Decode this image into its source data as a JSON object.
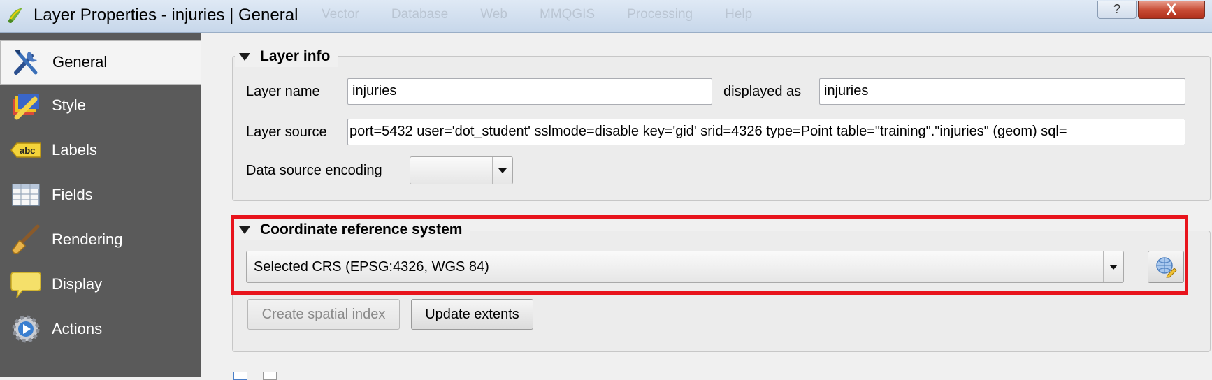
{
  "window": {
    "title": "Layer Properties - injuries | General",
    "background_menu": [
      "Vector",
      "Database",
      "Web",
      "MMQGIS",
      "Processing",
      "Help"
    ],
    "help_label": "?",
    "close_label": "X"
  },
  "sidebar": {
    "items": [
      {
        "label": "General",
        "icon": "tools-icon",
        "selected": true
      },
      {
        "label": "Style",
        "icon": "style-brush-icon"
      },
      {
        "label": "Labels",
        "icon": "abc-labels-icon"
      },
      {
        "label": "Fields",
        "icon": "table-fields-icon"
      },
      {
        "label": "Rendering",
        "icon": "paintbrush-icon"
      },
      {
        "label": "Display",
        "icon": "speech-bubble-icon"
      },
      {
        "label": "Actions",
        "icon": "gear-play-icon"
      }
    ]
  },
  "layer_info": {
    "title": "Layer info",
    "layer_name_label": "Layer name",
    "layer_name_value": "injuries",
    "displayed_as_label": "displayed as",
    "displayed_as_value": "injuries",
    "layer_source_label": "Layer source",
    "layer_source_value": "port=5432 user='dot_student' sslmode=disable key='gid' srid=4326 type=Point table=\"training\".\"injuries\" (geom) sql=",
    "encoding_label": "Data source encoding",
    "encoding_value": ""
  },
  "crs": {
    "title": "Coordinate reference system",
    "selected": "Selected CRS (EPSG:4326, WGS 84)",
    "select_crs_icon": "globe-crs-icon",
    "create_index_label": "Create spatial index",
    "update_extents_label": "Update extents"
  },
  "colors": {
    "highlight": "#e8141c",
    "sidebar_bg": "#5a5a5a",
    "close_button": "#c74a33"
  }
}
